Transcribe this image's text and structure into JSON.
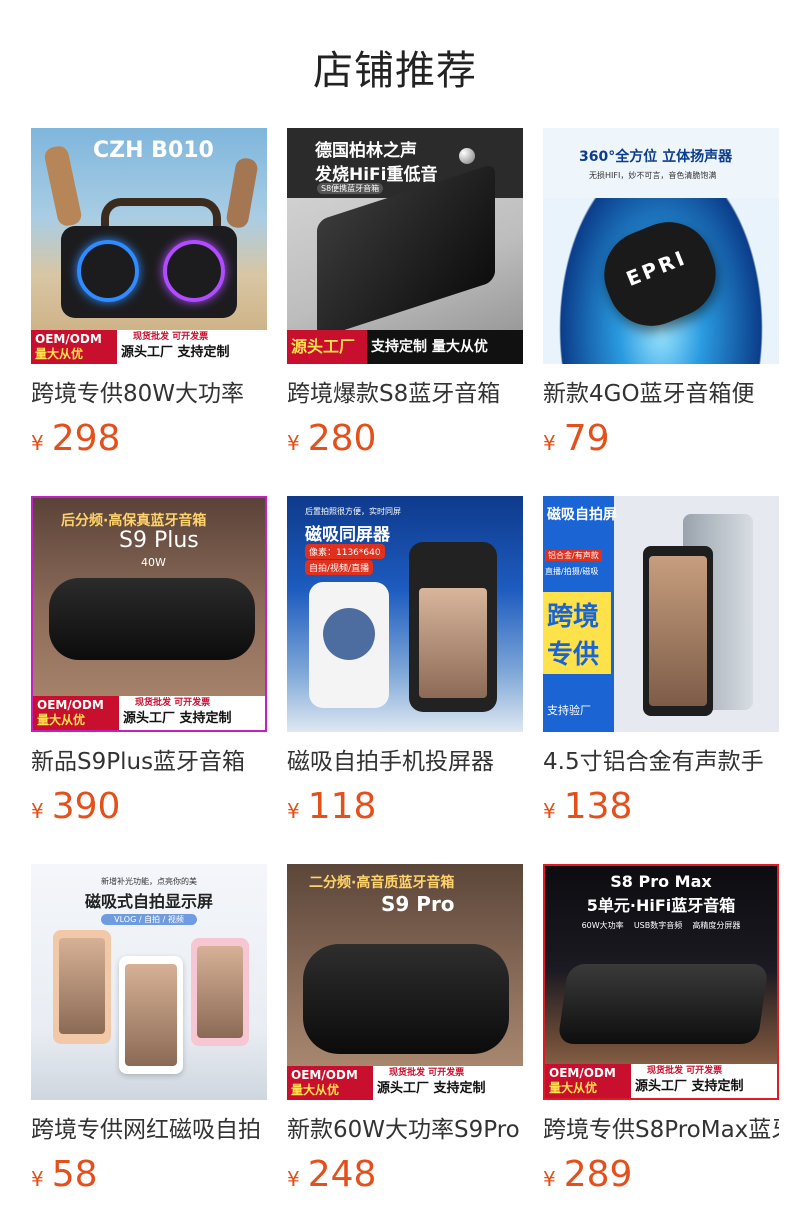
{
  "page": {
    "title": "店铺推荐"
  },
  "currency": "¥",
  "products": [
    {
      "name": "跨境专供80W大功率",
      "price": "298",
      "image_text": {
        "headline": "CZH B010",
        "badge_left_1": "OEM/ODM",
        "badge_left_2": "量大从优",
        "badge_right_top": "现货批发  可开发票",
        "badge_right_bottom": "源头工厂 支持定制"
      }
    },
    {
      "name": "跨境爆款S8蓝牙音箱",
      "price": "280",
      "image_text": {
        "headline": "德国柏林之声",
        "subline": "发烧HiFi重低音",
        "tag": "S8便携蓝牙音箱",
        "badge_left": "源头工厂",
        "badge_right": "支持定制  量大从优"
      }
    },
    {
      "name": "新款4GO蓝牙音箱便",
      "price": "79",
      "image_text": {
        "headline": "360°全方位 立体扬声器",
        "subline": "无损HIFI，妙不可言，音色清脆饱满",
        "logo": "EPRI"
      }
    },
    {
      "name": "新品S9Plus蓝牙音箱",
      "price": "390",
      "image_text": {
        "headline": "后分频·高保真蓝牙音箱",
        "model": "S9 Plus",
        "power": "40W",
        "badge_left_1": "OEM/ODM",
        "badge_left_2": "量大从优",
        "badge_right_top": "现货批发  可开发票",
        "badge_right_bottom": "源头工厂 支持定制"
      }
    },
    {
      "name": "磁吸自拍手机投屏器",
      "price": "118",
      "image_text": {
        "topline": "后置拍照很方便，实时同屏",
        "headline": "磁吸同屏器",
        "spec": "像素：1136*640",
        "features": "自拍/视频/直播"
      }
    },
    {
      "name": "4.5寸铝合金有声款手",
      "price": "138",
      "image_text": {
        "headline": "磁吸自拍屏",
        "tag": "铝合金/有声款",
        "features": "直播/拍摄/磁吸",
        "big_1": "跨境",
        "big_2": "专供",
        "footer": "支持验厂"
      }
    },
    {
      "name": "跨境专供网红磁吸自拍",
      "price": "58",
      "image_text": {
        "topline": "新增补光功能，点亮你的美",
        "headline": "磁吸式自拍显示屏",
        "tag": "VLOG / 自拍 / 视频"
      }
    },
    {
      "name": "新款60W大功率S9Pro",
      "price": "248",
      "image_text": {
        "headline": "二分频·高音质蓝牙音箱",
        "model": "S9 Pro",
        "badge_left_1": "OEM/ODM",
        "badge_left_2": "量大从优",
        "badge_right_top": "现货批发  可开发票",
        "badge_right_bottom": "源头工厂 支持定制"
      }
    },
    {
      "name": "跨境专供S8ProMax蓝牙",
      "price": "289",
      "image_text": {
        "model": "S8 Pro Max",
        "headline": "5单元·HiFi蓝牙音箱",
        "features": "60W大功率    USB数字音频    高精度分屏器",
        "badge_left_1": "OEM/ODM",
        "badge_left_2": "量大从优",
        "badge_right_top": "现货批发  可开发票",
        "badge_right_bottom": "源头工厂 支持定制"
      }
    }
  ],
  "colors": {
    "price": "#e4501c",
    "badge_red": "#c8102e"
  }
}
